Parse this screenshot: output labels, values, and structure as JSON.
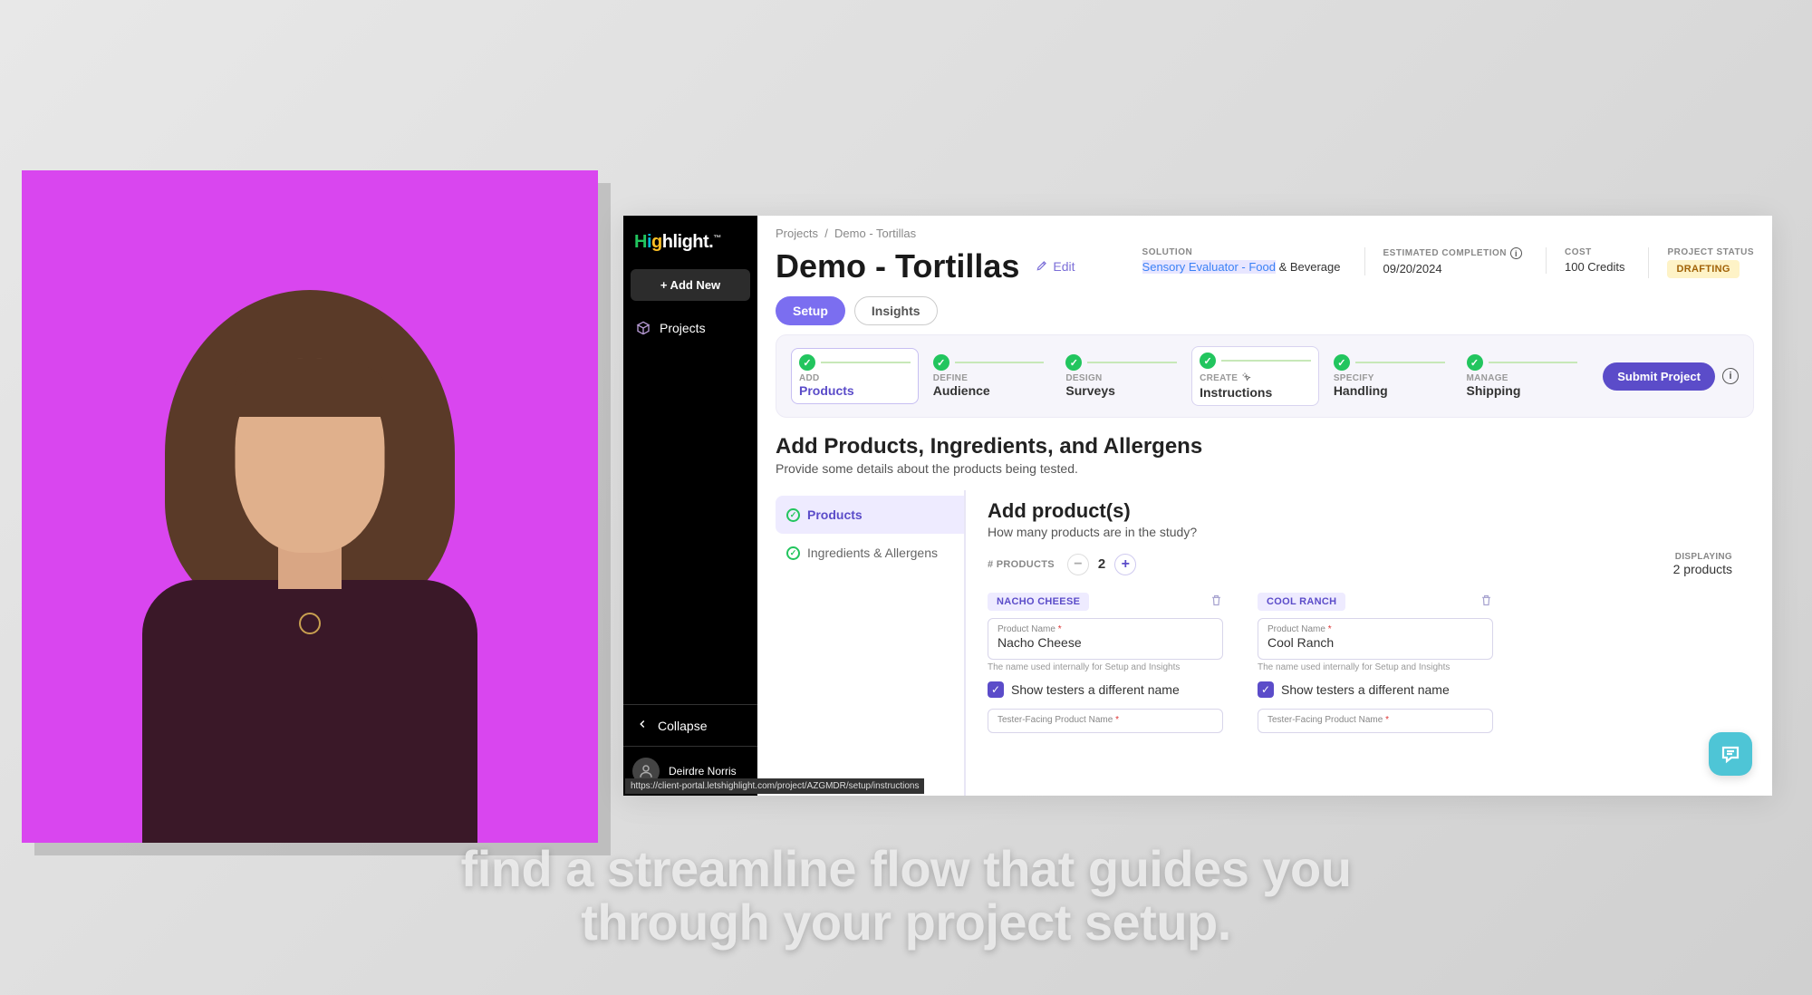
{
  "logo_text": "Highlight.",
  "sidebar": {
    "add_new": "+ Add New",
    "projects": "Projects",
    "collapse": "Collapse",
    "user_name": "Deirdre Norris"
  },
  "url_tooltip": "https://client-portal.letshighlight.com/project/AZGMDR/setup/instructions",
  "breadcrumb": {
    "root": "Projects",
    "current": "Demo - Tortillas"
  },
  "header": {
    "title": "Demo - Tortillas",
    "edit": "Edit",
    "meta": {
      "solution_label": "SOLUTION",
      "solution_link": "Sensory Evaluator - Food",
      "solution_rest": " & Beverage",
      "completion_label": "ESTIMATED COMPLETION",
      "completion_value": "09/20/2024",
      "cost_label": "COST",
      "cost_value": "100 Credits",
      "status_label": "PROJECT STATUS",
      "status_value": "DRAFTING"
    }
  },
  "tabs": {
    "setup": "Setup",
    "insights": "Insights"
  },
  "steps": [
    {
      "sub": "ADD",
      "main": "Products"
    },
    {
      "sub": "DEFINE",
      "main": "Audience"
    },
    {
      "sub": "DESIGN",
      "main": "Surveys"
    },
    {
      "sub": "CREATE",
      "main": "Instructions"
    },
    {
      "sub": "SPECIFY",
      "main": "Handling"
    },
    {
      "sub": "MANAGE",
      "main": "Shipping"
    }
  ],
  "submit_label": "Submit Project",
  "section": {
    "title": "Add Products, Ingredients, and Allergens",
    "desc": "Provide some details about the products being tested."
  },
  "sub_sidebar": {
    "products": "Products",
    "ingredients": "Ingredients & Allergens"
  },
  "form": {
    "title": "Add product(s)",
    "sub": "How many products are in the study?",
    "count_label": "# PRODUCTS",
    "count_value": "2",
    "displaying_label": "DISPLAYING",
    "displaying_value": "2 products",
    "product_name_label": "Product Name",
    "hint": "The name used internally for Setup and Insights",
    "show_testers": "Show testers a different name",
    "tester_name_label": "Tester-Facing Product Name",
    "products": [
      {
        "chip": "NACHO CHEESE",
        "name": "Nacho Cheese"
      },
      {
        "chip": "COOL RANCH",
        "name": "Cool Ranch"
      }
    ]
  },
  "caption_line1": "find a streamline flow that guides you",
  "caption_line2": "through your project setup."
}
